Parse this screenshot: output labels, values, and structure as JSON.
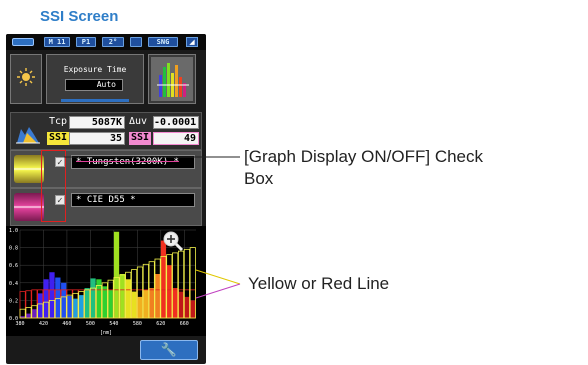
{
  "page": {
    "title": "SSI Screen",
    "callout_graph": "[Graph Display ON/OFF] Check Box",
    "callout_graph_line1": "[Graph Display ON/OFF] Check",
    "callout_graph_line2": "Box",
    "callout_line": "Yellow or Red Line"
  },
  "device": {
    "status": {
      "memory": "M 11",
      "preset": "P1",
      "angle": "2°",
      "mode": "SNG"
    },
    "exposure": {
      "label": "Exposure Time",
      "value": "Auto"
    },
    "measure": {
      "tcp_label": "Tcp",
      "tcp_value": "5087K",
      "duv_label": "Δuv",
      "duv_value": "-0.0001",
      "ssi1_label": "SSI",
      "ssi1_value": "35",
      "ssi2_label": "SSI",
      "ssi2_value": "49"
    },
    "lights": [
      {
        "name": "* Tungsten(3200K) *",
        "checked": true,
        "color": "#e8d84a"
      },
      {
        "name": "* CIE D55 *",
        "checked": true,
        "color": "#e0409a"
      }
    ],
    "check_mark": "✓"
  },
  "chart_data": {
    "type": "bar",
    "x_ticks": [
      "380",
      "420",
      "460",
      "500",
      "540",
      "580",
      "620",
      "660"
    ],
    "y_ticks": [
      "0.0",
      "0.2",
      "0.4",
      "0.6",
      "0.8",
      "1.0"
    ],
    "xlabel": "[nm]",
    "ylim": [
      0,
      1.0
    ],
    "xlim": [
      380,
      680
    ],
    "measured_spectrum": {
      "x": [
        380,
        390,
        400,
        410,
        420,
        430,
        440,
        450,
        460,
        470,
        480,
        490,
        500,
        510,
        520,
        530,
        540,
        550,
        560,
        570,
        580,
        590,
        600,
        610,
        620,
        630,
        640,
        650,
        660,
        670
      ],
      "y": [
        0.02,
        0.05,
        0.1,
        0.28,
        0.44,
        0.52,
        0.46,
        0.4,
        0.25,
        0.22,
        0.26,
        0.34,
        0.45,
        0.44,
        0.36,
        0.32,
        0.98,
        0.5,
        0.44,
        0.3,
        0.24,
        0.32,
        0.34,
        0.5,
        0.88,
        0.6,
        0.34,
        0.3,
        0.24,
        0.2
      ]
    },
    "reference_tungsten": [
      0.1,
      0.12,
      0.14,
      0.16,
      0.18,
      0.2,
      0.22,
      0.24,
      0.26,
      0.28,
      0.3,
      0.32,
      0.34,
      0.37,
      0.4,
      0.43,
      0.46,
      0.49,
      0.52,
      0.55,
      0.58,
      0.61,
      0.64,
      0.67,
      0.7,
      0.72,
      0.74,
      0.76,
      0.78,
      0.8
    ],
    "reference_d55": [
      0.3,
      0.31,
      0.32,
      0.32,
      0.32,
      0.32,
      0.32,
      0.32,
      0.32,
      0.32,
      0.32,
      0.32,
      0.32,
      0.32,
      0.32,
      0.32,
      0.32,
      0.32,
      0.32,
      0.32,
      0.32,
      0.32,
      0.32,
      0.32,
      0.32,
      0.32,
      0.32,
      0.32,
      0.32,
      0.32
    ]
  },
  "colors": {
    "title_blue": "#2f7ec8",
    "tungsten_yellow": "#f2f24a",
    "d55_red": "#e02020",
    "callout_line": "#c040c0",
    "ssi_yellow": "#f5e63a",
    "ssi_pink": "#f28ad0"
  },
  "icons": [
    "battery-icon",
    "bluetooth-icon",
    "sun-icon",
    "histogram-icon",
    "spectrum-icon",
    "zoom-in-icon",
    "wrench-icon"
  ]
}
